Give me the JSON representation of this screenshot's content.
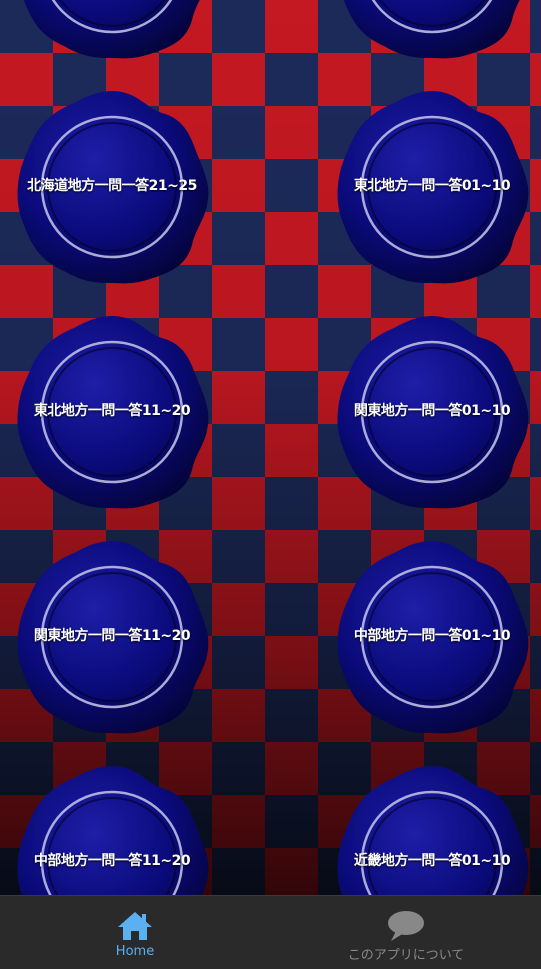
{
  "quiz_buttons": [
    {
      "label": ""
    },
    {
      "label": ""
    },
    {
      "label": "北海道地方一問一答21~25"
    },
    {
      "label": "東北地方一問一答01~10"
    },
    {
      "label": "東北地方一問一答11~20"
    },
    {
      "label": "関東地方一問一答01~10"
    },
    {
      "label": "関東地方一問一答11~20"
    },
    {
      "label": "中部地方一問一答01~10"
    },
    {
      "label": "中部地方一問一答11~20"
    },
    {
      "label": "近畿地方一問一答01~10"
    }
  ],
  "bottom_nav": {
    "home_label": "Home",
    "about_label": "このアプリについて",
    "active_color": "#5ab0f0",
    "inactive_color": "#888888"
  },
  "colors": {
    "board_red": "#c41822",
    "board_navy": "#1c2a5a",
    "seal_blue": "#0a0a7a",
    "nav_background": "#2a2a2a"
  }
}
